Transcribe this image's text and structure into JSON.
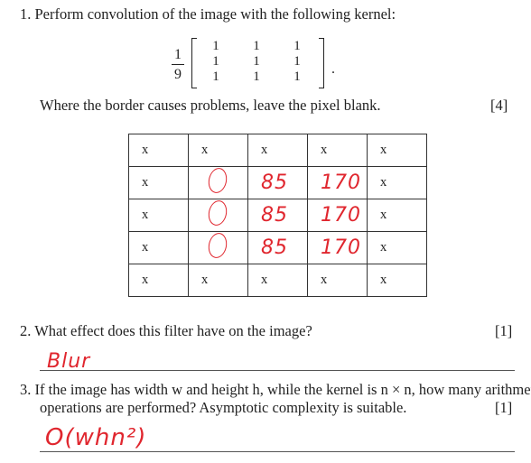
{
  "questions": [
    {
      "number": "1.",
      "text": "Perform convolution of the image with the following kernel:"
    },
    {
      "number": "2.",
      "text": "What effect does this filter have on the image?",
      "marks": "[1]"
    },
    {
      "number": "3.",
      "text_line1": "If the image has width w and height h, while the kernel is n × n, how many arithmetic",
      "text_line2": "operations are performed? Asymptotic complexity is suitable.",
      "marks": "[1]"
    }
  ],
  "kernel": {
    "fraction_numerator": "1",
    "fraction_denominator": "9",
    "matrix": [
      [
        "1",
        "1",
        "1"
      ],
      [
        "1",
        "1",
        "1"
      ],
      [
        "1",
        "1",
        "1"
      ]
    ],
    "period": "."
  },
  "instruction": {
    "text": "Where the border causes problems, leave the pixel blank.",
    "marks": "[4]"
  },
  "grid": [
    [
      "x",
      "x",
      "x",
      "x",
      "x"
    ],
    [
      "x",
      "0",
      "85",
      "170",
      "x"
    ],
    [
      "x",
      "0",
      "85",
      "170",
      "x"
    ],
    [
      "x",
      "0",
      "85",
      "170",
      "x"
    ],
    [
      "x",
      "x",
      "x",
      "x",
      "x"
    ]
  ],
  "answers": {
    "q2": "Blur",
    "q3": "O(whn²)"
  },
  "colors": {
    "ink": "#222222",
    "handwriting": "#e0262e"
  }
}
